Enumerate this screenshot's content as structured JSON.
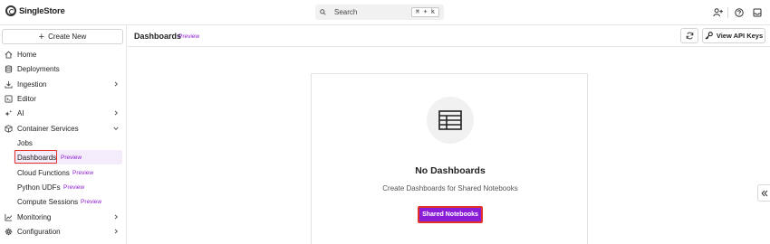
{
  "app": {
    "logo_text": "SingleStore"
  },
  "topbar": {
    "search_placeholder": "Search",
    "search_shortcut": "⌘ + k",
    "icons": [
      "add-user-icon",
      "help-icon",
      "inbox-icon"
    ]
  },
  "sidebar": {
    "create_label": "Create New",
    "items": [
      {
        "label": "Home",
        "icon": "home-icon"
      },
      {
        "label": "Deployments",
        "icon": "database-icon"
      },
      {
        "label": "Ingestion",
        "icon": "download-icon",
        "chevron": "right"
      },
      {
        "label": "Editor",
        "icon": "editor-icon"
      },
      {
        "label": "AI",
        "icon": "sparkle-icon",
        "chevron": "right"
      },
      {
        "label": "Container Services",
        "icon": "container-icon",
        "chevron": "down"
      }
    ],
    "sub_items": [
      {
        "label": "Jobs",
        "badge": ""
      },
      {
        "label": "Dashboards",
        "badge": "Preview",
        "active": true
      },
      {
        "label": "Cloud Functions",
        "badge": "Preview"
      },
      {
        "label": "Python UDFs",
        "badge": "Preview"
      },
      {
        "label": "Compute Sessions",
        "badge": "Preview"
      }
    ],
    "bottom_items": [
      {
        "label": "Monitoring",
        "icon": "chart-icon",
        "chevron": "right"
      },
      {
        "label": "Configuration",
        "icon": "gear-icon",
        "chevron": "right"
      }
    ]
  },
  "header": {
    "title": "Dashboards",
    "badge": "Preview",
    "api_keys_label": "View API Keys"
  },
  "empty_state": {
    "icon": "table-icon",
    "title": "No Dashboards",
    "subtitle": "Create Dashboards for Shared Notebooks",
    "button_label": "Shared Notebooks"
  },
  "colors": {
    "accent": "#8a1ed6",
    "badge": "#8c1bd3",
    "highlight": "#e0312b",
    "active_bg": "#f4ecfb"
  }
}
